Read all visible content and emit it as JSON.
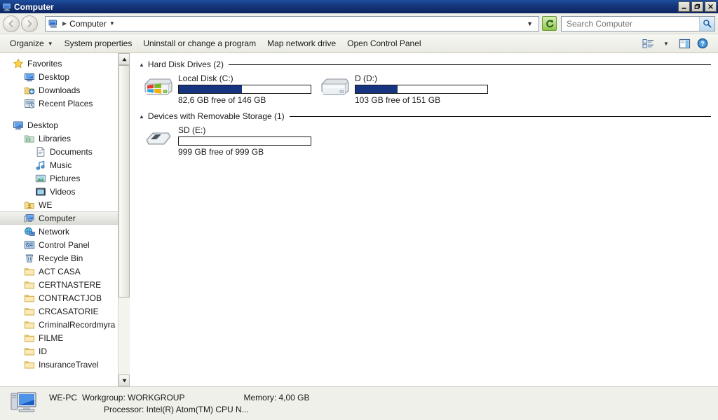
{
  "window": {
    "title": "Computer",
    "icon": "computer-icon",
    "controls": {
      "minimize": "_",
      "restore": "❐",
      "close": "✕"
    }
  },
  "address_bar": {
    "back_label": "◀",
    "forward_label": "▶",
    "breadcrumb_icon": "computer-icon",
    "breadcrumb_separator": "▶",
    "breadcrumb_text": "Computer",
    "breadcrumb_dropdown": "▼",
    "expand_dropdown": "▼",
    "refresh_icon": "↻",
    "search": {
      "placeholder": "Search Computer",
      "value": "",
      "icon": "search-icon",
      "icon_glyph": "⚲"
    }
  },
  "toolbar": {
    "organize": "Organize",
    "organize_caret": "▼",
    "system_properties": "System properties",
    "uninstall": "Uninstall or change a program",
    "map_drive": "Map network drive",
    "control_panel": "Open Control Panel",
    "view_caret": "▼"
  },
  "sidebar": {
    "items": [
      {
        "label": "Favorites",
        "icon": "star-icon",
        "indent": 0,
        "selected": false
      },
      {
        "label": "Desktop",
        "icon": "desktop-icon",
        "indent": 1,
        "selected": false
      },
      {
        "label": "Downloads",
        "icon": "downloads-icon",
        "indent": 1,
        "selected": false
      },
      {
        "label": "Recent Places",
        "icon": "recent-places-icon",
        "indent": 1,
        "selected": false
      },
      {
        "label": "Desktop",
        "icon": "desktop-icon",
        "indent": 0,
        "selected": false
      },
      {
        "label": "Libraries",
        "icon": "libraries-icon",
        "indent": 1,
        "selected": false
      },
      {
        "label": "Documents",
        "icon": "documents-icon",
        "indent": 2,
        "selected": false
      },
      {
        "label": "Music",
        "icon": "music-icon",
        "indent": 2,
        "selected": false
      },
      {
        "label": "Pictures",
        "icon": "pictures-icon",
        "indent": 2,
        "selected": false
      },
      {
        "label": "Videos",
        "icon": "videos-icon",
        "indent": 2,
        "selected": false
      },
      {
        "label": "WE",
        "icon": "user-folder-icon",
        "indent": 1,
        "selected": false
      },
      {
        "label": "Computer",
        "icon": "computer-icon",
        "indent": 1,
        "selected": true
      },
      {
        "label": "Network",
        "icon": "network-icon",
        "indent": 1,
        "selected": false
      },
      {
        "label": "Control Panel",
        "icon": "control-panel-icon",
        "indent": 1,
        "selected": false
      },
      {
        "label": "Recycle Bin",
        "icon": "recycle-bin-icon",
        "indent": 1,
        "selected": false
      },
      {
        "label": "ACT CASA",
        "icon": "folder-icon",
        "indent": 1,
        "selected": false
      },
      {
        "label": "CERTNASTERE",
        "icon": "folder-icon",
        "indent": 1,
        "selected": false
      },
      {
        "label": "CONTRACTJOB",
        "icon": "folder-icon",
        "indent": 1,
        "selected": false
      },
      {
        "label": "CRCASATORIE",
        "icon": "folder-icon",
        "indent": 1,
        "selected": false
      },
      {
        "label": "CriminalRecordmyra",
        "icon": "folder-icon",
        "indent": 1,
        "selected": false
      },
      {
        "label": "FILME",
        "icon": "folder-icon",
        "indent": 1,
        "selected": false
      },
      {
        "label": "ID",
        "icon": "folder-icon",
        "indent": 1,
        "selected": false
      },
      {
        "label": "InsuranceTravel",
        "icon": "folder-icon",
        "indent": 1,
        "selected": false
      }
    ],
    "scroll_up": "▲",
    "scroll_down": "▼"
  },
  "main": {
    "sections": [
      {
        "title": "Hard Disk Drives (2)",
        "collapse_glyph": "▲",
        "drives": [
          {
            "name": "Local Disk (C:)",
            "free_text": "82,6 GB free of 146 GB",
            "used_percent": 48,
            "icon": "hard-drive-windows-icon"
          },
          {
            "name": "D (D:)",
            "free_text": "103 GB free of 151 GB",
            "used_percent": 32,
            "icon": "hard-drive-icon"
          }
        ]
      },
      {
        "title": "Devices with Removable Storage (1)",
        "collapse_glyph": "▲",
        "drives": [
          {
            "name": "SD (E:)",
            "free_text": "999 GB free of 999 GB",
            "used_percent": 0,
            "icon": "sd-card-icon"
          }
        ]
      }
    ]
  },
  "status_bar": {
    "computer_icon": "computer-monitor-icon",
    "computer_name": "WE-PC",
    "workgroup": "Workgroup: WORKGROUP",
    "memory": "Memory: 4,00 GB",
    "processor": "Processor: Intel(R) Atom(TM) CPU N..."
  },
  "colors": {
    "titlebar_start": "#1f4ea0",
    "titlebar_end": "#0d2660",
    "bar_fill": "#16347f",
    "selection": "#dcdcd6",
    "folder_yellow": "#f4dc8c"
  }
}
